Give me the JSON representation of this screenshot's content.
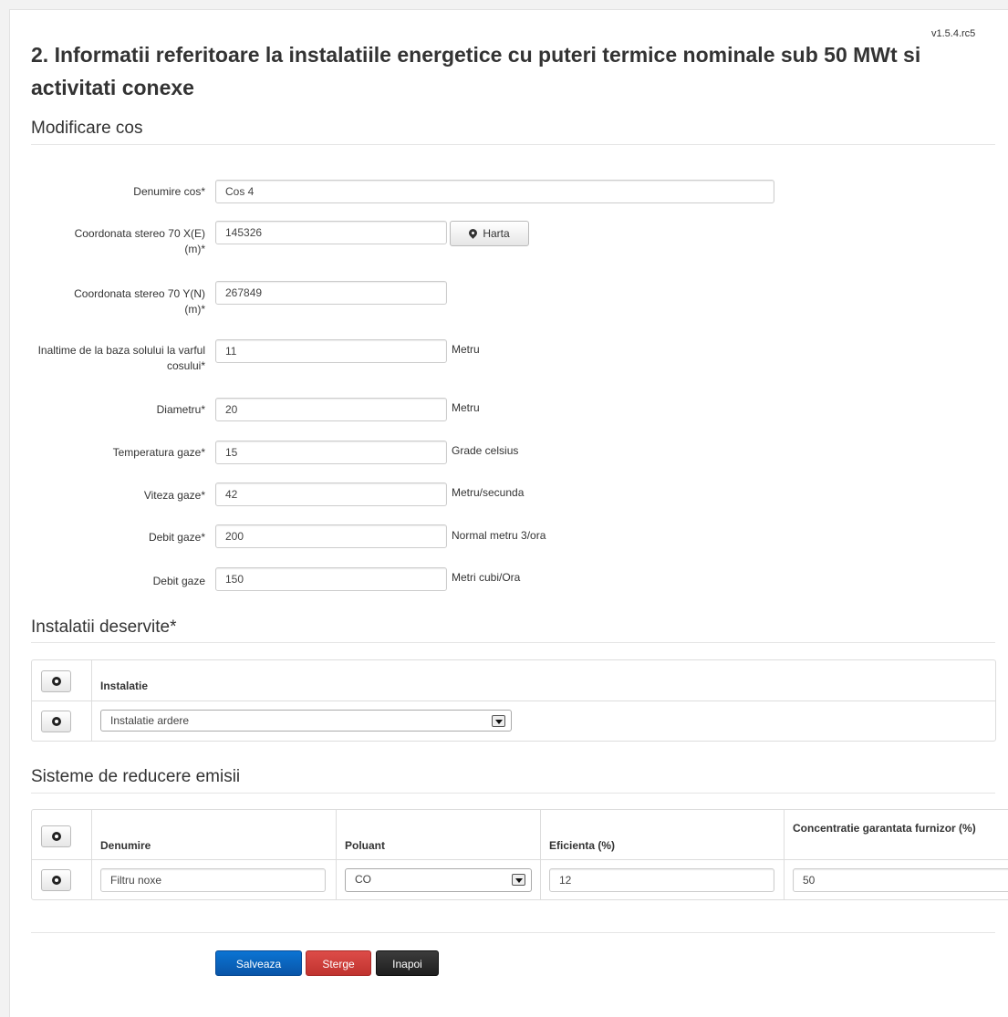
{
  "version": "v1.5.4.rc5",
  "page_title": "2. Informatii referitoare la instalatiile energetice cu puteri termice nominale sub 50 MWt si activitati conexe",
  "section_main": "Modificare cos",
  "fields": {
    "denumire": {
      "label": "Denumire cos*",
      "value": "Cos 4"
    },
    "coord_x": {
      "label": "Coordonata stereo 70 X(E) (m)*",
      "value": "145326",
      "button": "Harta"
    },
    "coord_y": {
      "label": "Coordonata stereo 70 Y(N) (m)*",
      "value": "267849"
    },
    "inaltime": {
      "label": "Inaltime de la baza solului la varful cosului*",
      "value": "11",
      "unit": "Metru"
    },
    "diametru": {
      "label": "Diametru*",
      "value": "20",
      "unit": "Metru"
    },
    "temperatura": {
      "label": "Temperatura gaze*",
      "value": "15",
      "unit": "Grade celsius"
    },
    "viteza": {
      "label": "Viteza gaze*",
      "value": "42",
      "unit": "Metru/secunda"
    },
    "debit1": {
      "label": "Debit gaze*",
      "value": "200",
      "unit": "Normal metru 3/ora"
    },
    "debit2": {
      "label": "Debit gaze",
      "value": "150",
      "unit": "Metri cubi/Ora"
    }
  },
  "instalatii": {
    "title": "Instalatii deservite*",
    "header": "Instalatie",
    "rows": [
      {
        "instalatie": "Instalatie ardere"
      }
    ]
  },
  "sisteme": {
    "title": "Sisteme de reducere emisii",
    "headers": [
      "Denumire",
      "Poluant",
      "Eficienta (%)",
      "Concentratie garantata furnizor (%)"
    ],
    "rows": [
      {
        "denumire": "Filtru noxe",
        "poluant": "CO",
        "eficienta": "12",
        "concentratie": "50"
      }
    ]
  },
  "buttons": {
    "save": "Salveaza",
    "delete": "Sterge",
    "back": "Inapoi"
  }
}
